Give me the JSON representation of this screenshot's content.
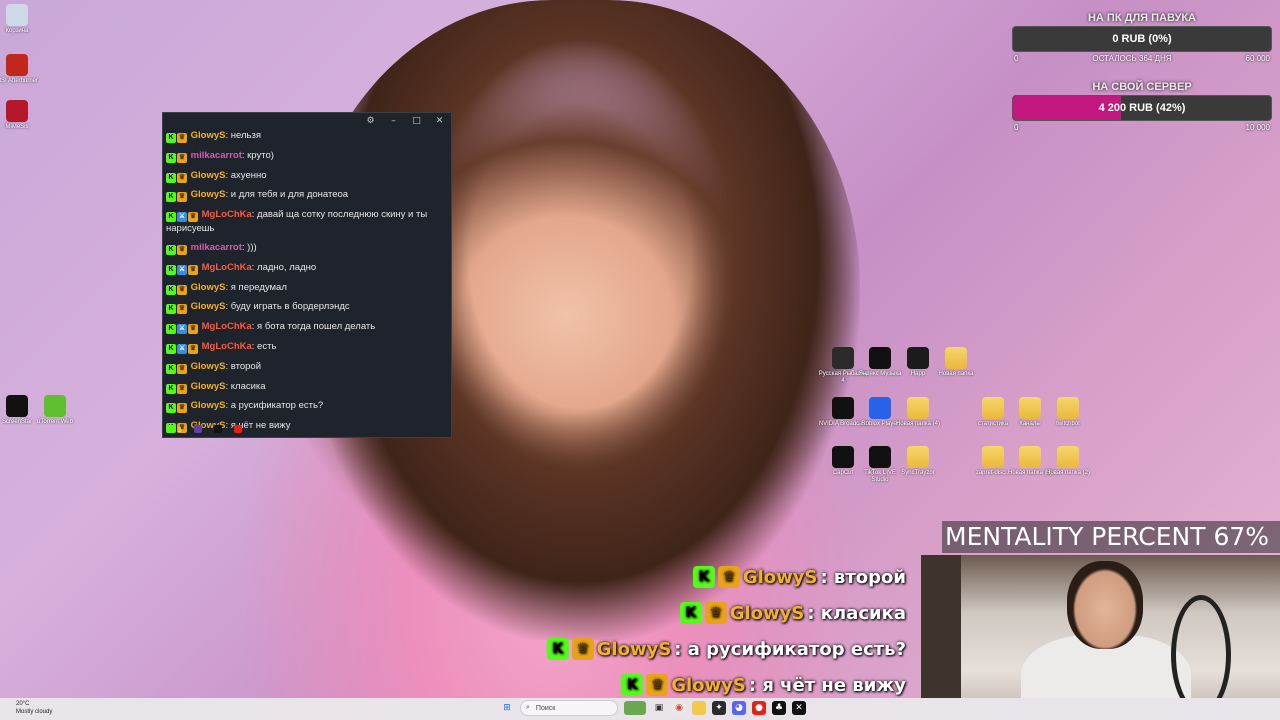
{
  "desktop_icons_left": [
    {
      "label": "Корзина",
      "icon": "recycle-bin-icon",
      "color": "#cfd8e6"
    },
    {
      "label": "MSI Afterburner",
      "icon": "msi-afterburner-icon",
      "color": "#c0271d"
    },
    {
      "label": "MiMeSis",
      "icon": "mimesis-icon",
      "color": "#b5172b"
    },
    {
      "label": "ScreenStar",
      "icon": "screenstar-icon",
      "color": "#111111"
    },
    {
      "label": "uTorrent Web",
      "icon": "utorrent-icon",
      "color": "#5fbf2d"
    }
  ],
  "desktop_icons_right": [
    {
      "label": "Русская Рыбалка 4",
      "icon": "fishing-game-icon",
      "color": "#2b2b2b"
    },
    {
      "label": "Яндекс Музыка",
      "icon": "yandex-music-icon",
      "color": "#111111"
    },
    {
      "label": "Happ",
      "icon": "happ-icon",
      "color": "#1b1b1b"
    },
    {
      "label": "Новая папка",
      "icon": "folder-icon",
      "color": "#f2c94c"
    },
    {
      "label": "NVIDIA Broadcast",
      "icon": "nvidia-broadcast-icon",
      "color": "#111111"
    },
    {
      "label": "Roblox Player",
      "icon": "roblox-icon",
      "color": "#2862e9"
    },
    {
      "label": "Новая папка (4)",
      "icon": "folder-icon",
      "color": "#f2c94c"
    },
    {
      "label": "статистика",
      "icon": "folder-icon",
      "color": "#f2c94c"
    },
    {
      "label": "Каналы",
      "icon": "folder-icon",
      "color": "#f2c94c"
    },
    {
      "label": "twitchbot",
      "icon": "folder-icon",
      "color": "#f2c94c"
    },
    {
      "label": "CapCut",
      "icon": "capcut-icon",
      "color": "#111111"
    },
    {
      "label": "TikTok LIVE Studio",
      "icon": "tiktok-icon",
      "color": "#111111"
    },
    {
      "label": "SyncTrayzor",
      "icon": "folder-icon",
      "color": "#f2c94c"
    },
    {
      "label": "zapret-disc...",
      "icon": "folder-icon",
      "color": "#f2c94c"
    },
    {
      "label": "Новая папка (3)",
      "icon": "folder-icon",
      "color": "#f2c94c"
    },
    {
      "label": "Новая папка (2)",
      "icon": "folder-icon",
      "color": "#f2c94c"
    }
  ],
  "chat": {
    "messages": [
      {
        "user": "GlowyS",
        "color": "#f2b126",
        "sword": false,
        "text": ": нельзя"
      },
      {
        "user": "milkacarrot",
        "color": "#d65db1",
        "sword": false,
        "text": ": круто)"
      },
      {
        "user": "GlowyS",
        "color": "#f2b126",
        "sword": false,
        "text": ": ахуенно"
      },
      {
        "user": "GlowyS",
        "color": "#f2b126",
        "sword": false,
        "text": ": и для тебя и для донатеоа"
      },
      {
        "user": "MgLoChKa",
        "color": "#ff5a3c",
        "sword": true,
        "text": ": давай ща сотку последнюю скину и ты нарисуешь"
      },
      {
        "user": "milkacarrot",
        "color": "#d65db1",
        "sword": false,
        "text": ": )))"
      },
      {
        "user": "MgLoChKa",
        "color": "#ff5a3c",
        "sword": true,
        "text": ": ладно, ладно"
      },
      {
        "user": "GlowyS",
        "color": "#f2b126",
        "sword": false,
        "text": ": я передумал"
      },
      {
        "user": "GlowyS",
        "color": "#f2b126",
        "sword": false,
        "text": ": буду играть в бордерлэндс"
      },
      {
        "user": "MgLoChKa",
        "color": "#ff5a3c",
        "sword": true,
        "text": ": я бота тогда пошел делать"
      },
      {
        "user": "MgLoChKa",
        "color": "#ff5a3c",
        "sword": true,
        "text": ": есть"
      },
      {
        "user": "GlowyS",
        "color": "#f2b126",
        "sword": false,
        "text": ": второй"
      },
      {
        "user": "GlowyS",
        "color": "#f2b126",
        "sword": false,
        "text": ": класика"
      },
      {
        "user": "GlowyS",
        "color": "#f2b126",
        "sword": false,
        "text": ": а русификатор есть?"
      },
      {
        "user": "GlowyS",
        "color": "#f2b126",
        "sword": false,
        "text": ": я чёт не вижу"
      }
    ],
    "footer_count": "3"
  },
  "goals": [
    {
      "title": "НА ПК ДЛЯ ПАВУКА",
      "value_label": "0 RUB (0%)",
      "progress": 0,
      "min": "0",
      "center": "ОСТАЛОСЬ 364 ДНЯ",
      "max": "60 000",
      "fill": "#3a3a3a"
    },
    {
      "title": "НА СВОЙ СЕРВЕР",
      "value_label": "4 200 RUB (42%)",
      "progress": 42,
      "min": "0",
      "center": "",
      "max": "10 000",
      "fill": "#c2187f"
    }
  ],
  "overlay_chat": [
    {
      "user": "GlowyS",
      "text": ": второй"
    },
    {
      "user": "GlowyS",
      "text": ": класика"
    },
    {
      "user": "GlowyS",
      "text": ": а русификатор есть?"
    },
    {
      "user": "GlowyS",
      "text": ": я чёт не вижу"
    }
  ],
  "mentality": "MENTALITY PERCENT 67%",
  "taskbar": {
    "weather_temp": "20°C",
    "weather_desc": "Mostly cloudy",
    "search_placeholder": "Поиск"
  }
}
